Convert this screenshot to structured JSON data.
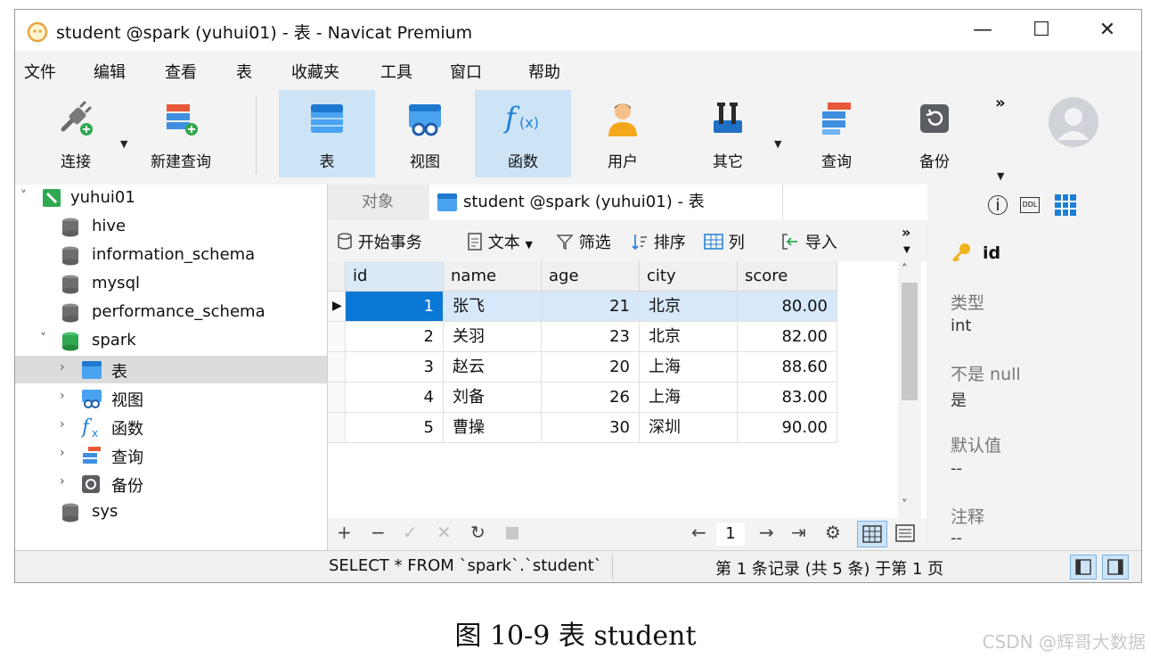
{
  "window": {
    "title": "student @spark (yuhui01) - 表 - Navicat Premium",
    "controls": {
      "minimize": "—",
      "maximize": "☐",
      "close": "✕"
    }
  },
  "menu": [
    "文件",
    "编辑",
    "查看",
    "表",
    "收藏夹",
    "工具",
    "窗口",
    "帮助"
  ],
  "toolbar": {
    "buttons": [
      {
        "label": "连接",
        "icon": "plug-icon"
      },
      {
        "label": "新建查询",
        "icon": "new-query-icon"
      },
      {
        "label": "表",
        "icon": "table-icon",
        "active": true
      },
      {
        "label": "视图",
        "icon": "view-icon"
      },
      {
        "label": "函数",
        "icon": "function-icon",
        "active": true
      },
      {
        "label": "用户",
        "icon": "user-icon"
      },
      {
        "label": "其它",
        "icon": "tools-icon"
      },
      {
        "label": "查询",
        "icon": "query-icon"
      },
      {
        "label": "备份",
        "icon": "backup-icon"
      }
    ],
    "overflow": "»"
  },
  "navigator": {
    "connection": "yuhui01",
    "databases": [
      "hive",
      "information_schema",
      "mysql",
      "performance_schema"
    ],
    "spark": {
      "name": "spark",
      "children": [
        "表",
        "视图",
        "函数",
        "查询",
        "备份"
      ]
    },
    "last": "sys"
  },
  "tabs": {
    "objects": "对象",
    "active": "student @spark (yuhui01) - 表"
  },
  "objectbar": {
    "begin_tx": "开始事务",
    "text": "文本",
    "filter": "筛选",
    "sort": "排序",
    "columns": "列",
    "import": "导入",
    "overflow": "»"
  },
  "grid": {
    "columns": [
      "id",
      "name",
      "age",
      "city",
      "score"
    ],
    "rows": [
      [
        "1",
        "张飞",
        "21",
        "北京",
        "80.00"
      ],
      [
        "2",
        "关羽",
        "23",
        "北京",
        "82.00"
      ],
      [
        "3",
        "赵云",
        "20",
        "上海",
        "88.60"
      ],
      [
        "4",
        "刘备",
        "26",
        "上海",
        "83.00"
      ],
      [
        "5",
        "曹操",
        "30",
        "深圳",
        "90.00"
      ]
    ]
  },
  "pager": {
    "page": "1"
  },
  "info": {
    "field": "id",
    "type_label": "类型",
    "type_value": "int",
    "notnull_label": "不是 null",
    "notnull_value": "是",
    "default_label": "默认值",
    "default_value": "--",
    "comment_label": "注释",
    "comment_value": "--"
  },
  "status": {
    "sql": "SELECT * FROM `spark`.`student`",
    "records": "第 1 条记录 (共 5 条) 于第 1 页"
  },
  "caption": "图 10-9  表 student",
  "watermark": "CSDN @辉哥大数据",
  "colors": {
    "accent": "#1e7fd6",
    "selected_row": "#d6e8fa",
    "selected_cell": "#0a78d7"
  }
}
